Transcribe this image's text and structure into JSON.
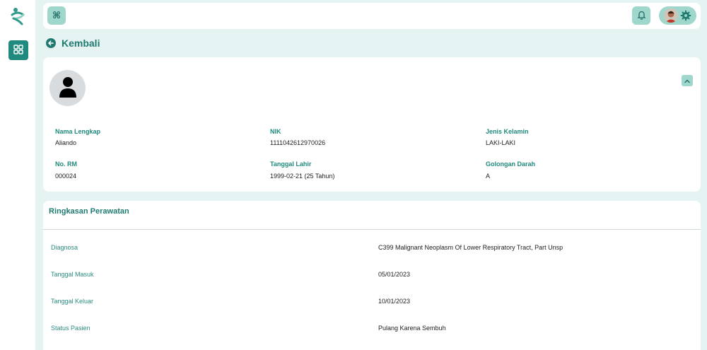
{
  "nav": {
    "back_label": "Kembali"
  },
  "patient": {
    "fields": [
      {
        "label": "Nama Lengkap",
        "value": "Aliando"
      },
      {
        "label": "NIK",
        "value": "1111042612970026"
      },
      {
        "label": "Jenis Kelamin",
        "value": "LAKI-LAKI"
      },
      {
        "label": "No. RM",
        "value": "000024"
      },
      {
        "label": "Tanggal Lahir",
        "value": "1999-02-21 (25 Tahun)"
      },
      {
        "label": "Golongan Darah",
        "value": "A"
      }
    ]
  },
  "summary": {
    "title": "Ringkasan Perawatan",
    "rows": [
      {
        "label": "Diagnosa",
        "value": "C399 Malignant Neoplasm Of Lower Respiratory Tract, Part Unsp"
      },
      {
        "label": "Tanggal Masuk",
        "value": "05/01/2023"
      },
      {
        "label": "Tanggal Keluar",
        "value": "10/01/2023"
      },
      {
        "label": "Status Pasien",
        "value": "Pulang Karena Sembuh"
      }
    ]
  },
  "colors": {
    "accent": "#1f8a7d",
    "accent_light": "#9fd7cd",
    "background": "#e6f3f3"
  },
  "icons": [
    "app-logo-icon",
    "dashboard-grid-icon",
    "command-icon",
    "bell-icon",
    "gear-icon",
    "arrow-left-icon",
    "user-icon",
    "chevron-up-icon"
  ]
}
